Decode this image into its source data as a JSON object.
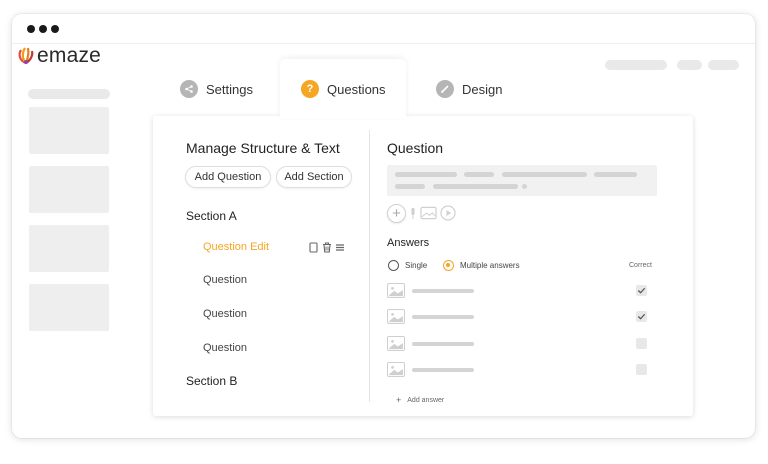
{
  "app": {
    "logo_text": "emaze",
    "accent_color": "#f5a623"
  },
  "tabs": [
    {
      "label": "Settings",
      "icon": "share-icon"
    },
    {
      "label": "Questions",
      "icon": "question-icon",
      "active": true
    },
    {
      "label": "Design",
      "icon": "brush-icon"
    }
  ],
  "left": {
    "title": "Manage Structure & Text",
    "add_question_label": "Add Question",
    "add_section_label": "Add Section",
    "section_a": "Section A",
    "questions": [
      {
        "label": "Question Edit",
        "active": true
      },
      {
        "label": "Question"
      },
      {
        "label": "Question"
      },
      {
        "label": "Question"
      }
    ],
    "section_b": "Section B"
  },
  "right": {
    "title": "Question",
    "answers_title": "Answers",
    "option_single": "Single",
    "option_multiple": "Multiple answers",
    "selected_option": "Multiple answers",
    "correct_label": "Correct",
    "answers": [
      {
        "correct": true
      },
      {
        "correct": true
      },
      {
        "correct": false
      },
      {
        "correct": false
      }
    ],
    "add_answer_label": "Add answer"
  }
}
